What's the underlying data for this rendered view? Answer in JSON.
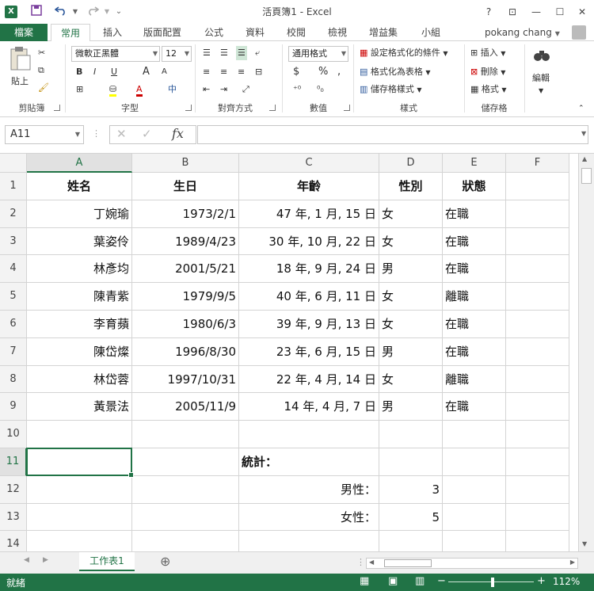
{
  "window": {
    "title": "活頁簿1 - Excel",
    "logo": "X",
    "controls": {
      "help": "?",
      "ribbon_options": "⊡",
      "minimize": "—",
      "maximize": "☐",
      "close": "✕"
    }
  },
  "qat": {
    "save": "💾",
    "undo": "↶",
    "redo": "↷",
    "more": "⌄"
  },
  "ribbon_tabs": {
    "file": "檔案",
    "tabs": [
      "常用",
      "插入",
      "版面配置",
      "公式",
      "資料",
      "校閱",
      "檢視",
      "增益集",
      "小組"
    ],
    "active": "常用",
    "user": "pokang chang"
  },
  "ribbon": {
    "clipboard": {
      "label": "剪貼簿",
      "paste": "貼上"
    },
    "font": {
      "label": "字型",
      "name": "微軟正黑體",
      "size": "12",
      "bold": "B",
      "italic": "I",
      "underline": "U",
      "grow": "A",
      "shrink": "A",
      "phonetic": "中"
    },
    "alignment": {
      "label": "對齊方式"
    },
    "number": {
      "label": "數值",
      "format": "通用格式",
      "currency": "$",
      "percent": "%",
      "comma": ","
    },
    "styles": {
      "label": "樣式",
      "conditional": "設定格式化的條件",
      "as_table": "格式化為表格",
      "cell_styles": "儲存格樣式"
    },
    "cells": {
      "label": "儲存格",
      "insert": "插入",
      "delete": "刪除",
      "format": "格式"
    },
    "editing": {
      "label": "編輯"
    }
  },
  "formula_bar": {
    "name_box": "A11",
    "fx": "fx",
    "cancel": "✕",
    "enter": "✓",
    "content": ""
  },
  "columns": [
    "A",
    "B",
    "C",
    "D",
    "E",
    "F"
  ],
  "selected_col": "A",
  "selected_row": "11",
  "rows": [
    "1",
    "2",
    "3",
    "4",
    "5",
    "6",
    "7",
    "8",
    "9",
    "10",
    "11",
    "12",
    "13",
    "14"
  ],
  "headers": {
    "name": "姓名",
    "birthday": "生日",
    "age": "年齡",
    "gender": "性別",
    "status": "狀態"
  },
  "data_rows": [
    {
      "name": "丁婉瑜",
      "birthday": "1973/2/1",
      "age": "47 年, 1 月, 15 日",
      "gender": "女",
      "status": "在職"
    },
    {
      "name": "葉姿伶",
      "birthday": "1989/4/23",
      "age": "30 年, 10 月, 22 日",
      "gender": "女",
      "status": "在職"
    },
    {
      "name": "林彥均",
      "birthday": "2001/5/21",
      "age": "18 年, 9 月, 24 日",
      "gender": "男",
      "status": "在職"
    },
    {
      "name": "陳青紫",
      "birthday": "1979/9/5",
      "age": "40 年, 6 月, 11 日",
      "gender": "女",
      "status": "離職"
    },
    {
      "name": "李育蘋",
      "birthday": "1980/6/3",
      "age": "39 年, 9 月, 13 日",
      "gender": "女",
      "status": "在職"
    },
    {
      "name": "陳岱燦",
      "birthday": "1996/8/30",
      "age": "23 年, 6 月, 15 日",
      "gender": "男",
      "status": "在職"
    },
    {
      "name": "林岱蓉",
      "birthday": "1997/10/31",
      "age": "22 年, 4 月, 14 日",
      "gender": "女",
      "status": "離職"
    },
    {
      "name": "黃景法",
      "birthday": "2005/11/9",
      "age": "14 年, 4 月, 7 日",
      "gender": "男",
      "status": "在職"
    }
  ],
  "stats": {
    "title": "統計：",
    "male_label": "男性：",
    "male_count": "3",
    "female_label": "女性：",
    "female_count": "5"
  },
  "sheets": {
    "tabs": [
      "工作表1"
    ],
    "add": "⊕",
    "prev": "◀",
    "next": "▶"
  },
  "status": {
    "mode": "就緒",
    "zoom": "112%",
    "zoom_minus": "−",
    "zoom_plus": "+"
  },
  "colors": {
    "accent": "#217346"
  }
}
